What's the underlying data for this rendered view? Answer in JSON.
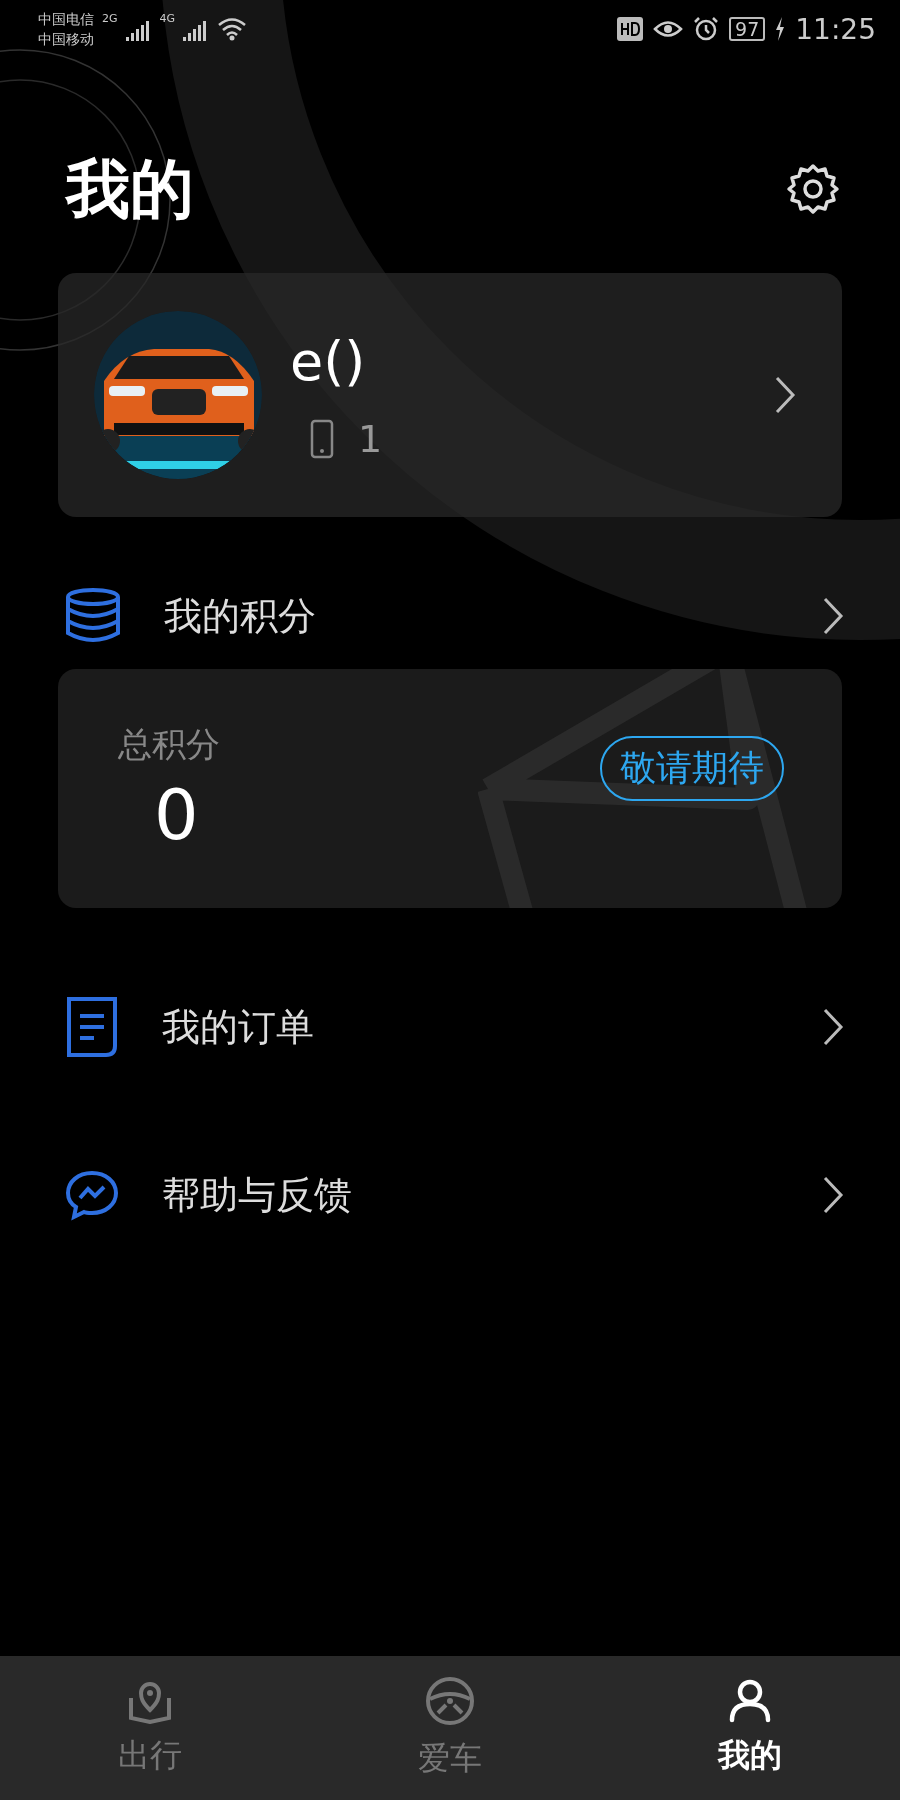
{
  "status_bar": {
    "carriers": [
      "中国电信",
      "中国移动"
    ],
    "networks": [
      "2G",
      "4G"
    ],
    "battery": "97",
    "time": "11:25"
  },
  "header": {
    "title": "我的"
  },
  "profile": {
    "username": "e()",
    "phone": "1"
  },
  "points": {
    "label": "我的积分",
    "total_label": "总积分",
    "total": "0",
    "badge": "敬请期待"
  },
  "menu": [
    {
      "kind": "orders",
      "label": "我的订单"
    },
    {
      "kind": "help",
      "label": "帮助与反馈"
    }
  ],
  "tabs": [
    {
      "kind": "trip",
      "label": "出行",
      "selected": false
    },
    {
      "kind": "car",
      "label": "爱车",
      "selected": false
    },
    {
      "kind": "me",
      "label": "我的",
      "selected": true
    }
  ]
}
